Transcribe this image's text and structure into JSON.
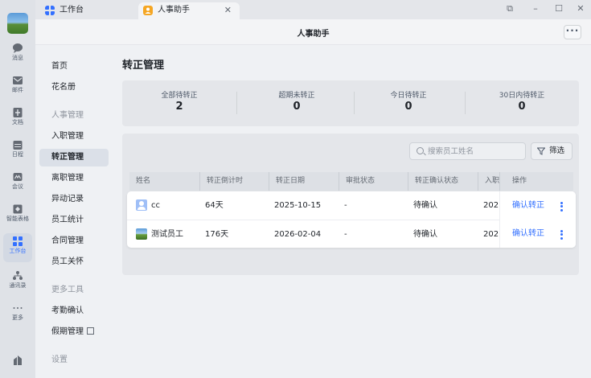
{
  "rail": {
    "items": [
      {
        "label": "消息",
        "icon": "chat-bubble-icon"
      },
      {
        "label": "邮件",
        "icon": "mail-icon"
      },
      {
        "label": "文档",
        "icon": "document-icon"
      },
      {
        "label": "日程",
        "icon": "calendar-icon"
      },
      {
        "label": "会议",
        "icon": "video-meeting-icon"
      },
      {
        "label": "智能表格",
        "icon": "smart-table-icon"
      },
      {
        "label": "工作台",
        "icon": "workbench-grid-icon"
      },
      {
        "label": "通讯录",
        "icon": "contacts-icon"
      },
      {
        "label": "更多",
        "icon": "more-dots-icon"
      }
    ]
  },
  "tabs": [
    {
      "label": "工作台"
    },
    {
      "label": "人事助手"
    }
  ],
  "titlebar": {
    "title": "人事助手",
    "more": "···"
  },
  "subnav": {
    "items": [
      {
        "label": "首页"
      },
      {
        "label": "花名册"
      },
      {
        "label": "人事管理"
      },
      {
        "label": "入职管理"
      },
      {
        "label": "转正管理"
      },
      {
        "label": "离职管理"
      },
      {
        "label": "异动记录"
      },
      {
        "label": "员工统计"
      },
      {
        "label": "合同管理"
      },
      {
        "label": "员工关怀"
      },
      {
        "label": "更多工具"
      },
      {
        "label": "考勤确认"
      },
      {
        "label": "假期管理"
      },
      {
        "label": "设置"
      }
    ]
  },
  "page": {
    "title": "转正管理"
  },
  "stats": [
    {
      "label": "全部待转正",
      "value": "2"
    },
    {
      "label": "超期未转正",
      "value": "0"
    },
    {
      "label": "今日待转正",
      "value": "0"
    },
    {
      "label": "30日内待转正",
      "value": "0"
    }
  ],
  "toolbar": {
    "search_placeholder": "搜索员工姓名",
    "filter_label": "筛选"
  },
  "table": {
    "columns": [
      "姓名",
      "转正倒计时",
      "转正日期",
      "审批状态",
      "转正确认状态",
      "入职",
      "操作"
    ],
    "rows": [
      {
        "name": "cc",
        "countdown": "64天",
        "date": "2025-10-15",
        "approval": "-",
        "confirm": "待确认",
        "join": "202",
        "action": "确认转正"
      },
      {
        "name": "测试员工",
        "countdown": "176天",
        "date": "2026-02-04",
        "approval": "-",
        "confirm": "待确认",
        "join": "202",
        "action": "确认转正"
      }
    ]
  },
  "colors": {
    "accent": "#3370ff"
  }
}
